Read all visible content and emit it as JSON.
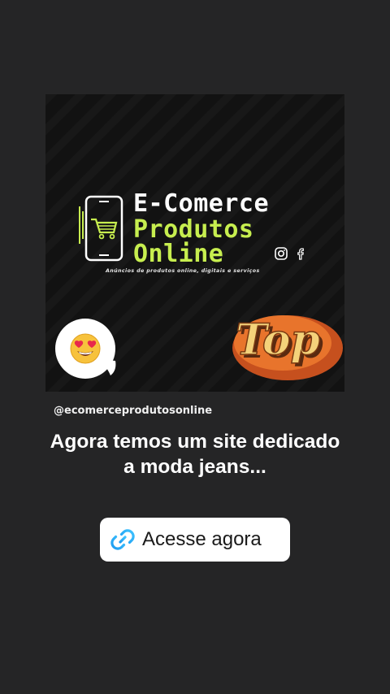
{
  "post": {
    "brand_line1": "E-Comerce",
    "brand_line2": "Produtos",
    "brand_line3": "Online",
    "tagline": "Anúncios de produtos online, digitais e serviços",
    "sticker_text": "Top",
    "emoji": "😍"
  },
  "story": {
    "mention": "@ecomerceprodutosonline",
    "caption_line1": "Agora temos um site dedicado",
    "caption_line2": "a moda jeans...",
    "link_label": "Acesse agora"
  },
  "icons": {
    "phone_logo": "phone-cart-icon",
    "instagram": "instagram-icon",
    "facebook": "facebook-icon",
    "link": "link-icon"
  },
  "colors": {
    "background": "#252526",
    "accent_green": "#c7ee4f",
    "link_blue": "#1d9bf0",
    "sticker_orange": "#e8742c"
  }
}
